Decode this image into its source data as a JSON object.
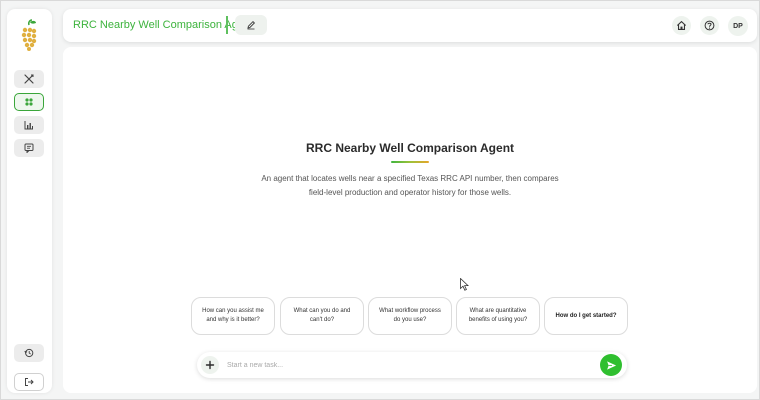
{
  "header": {
    "title": "RRC Nearby Well Comparison Agent",
    "avatar_initials": "DP",
    "icons": [
      "pencil-icon",
      "home-icon",
      "help-icon"
    ]
  },
  "sidebar": {
    "items": [
      {
        "name": "tools",
        "icon": "crossed-tools-icon",
        "active": false
      },
      {
        "name": "agents",
        "icon": "nodes-icon",
        "active": true
      },
      {
        "name": "analytics",
        "icon": "bar-chart-icon",
        "active": false
      },
      {
        "name": "chat",
        "icon": "message-icon",
        "active": false
      }
    ],
    "bottom": [
      {
        "name": "history",
        "icon": "history-icon"
      },
      {
        "name": "logout",
        "icon": "logout-icon"
      }
    ]
  },
  "main": {
    "agent_title": "RRC Nearby Well Comparison Agent",
    "agent_description": "An agent that locates wells near a specified Texas RRC API number, then compares field-level production and operator history for those wells.",
    "prompts": [
      "How can you assist me and why is it better?",
      "What can you do and can't do?",
      "What workflow process do you use?",
      "What are quantitative benefits of using you?",
      "How do I get started?"
    ],
    "composer": {
      "placeholder": "Start a new task...",
      "value": ""
    }
  },
  "colors": {
    "brand_green": "#3db33d",
    "send_green": "#2fbf2f",
    "accent_orange": "#e6a52a"
  }
}
